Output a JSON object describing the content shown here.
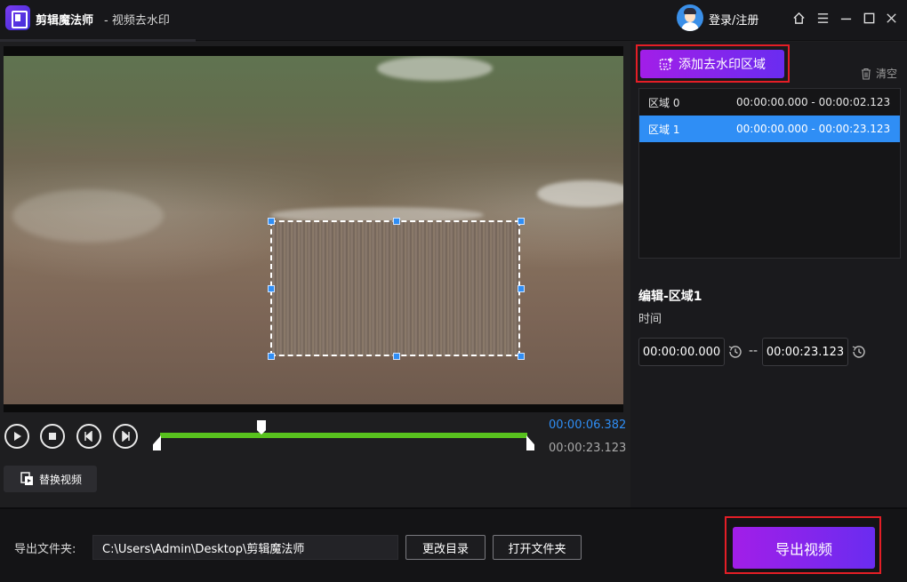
{
  "app": {
    "name": "剪辑魔法师",
    "subtitle": "- 视频去水印"
  },
  "header": {
    "login_label": "登录/注册"
  },
  "player": {
    "current_time": "00:00:06.382",
    "total_time": "00:00:23.123",
    "playhead_fraction": 0.276,
    "replace_video_label": "替换视频"
  },
  "watermark": {
    "add_region_label": "添加去水印区域",
    "clear_label": "清空",
    "regions": [
      {
        "name": "区域 0",
        "range": "00:00:00.000 - 00:00:02.123",
        "selected": false
      },
      {
        "name": "区域 1",
        "range": "00:00:00.000 - 00:00:23.123",
        "selected": true
      }
    ],
    "edit_title": "编辑-区域1",
    "time_label": "时间",
    "start_time": "00:00:00.000",
    "end_time": "00:00:23.123",
    "separator": "--"
  },
  "export": {
    "folder_label": "导出文件夹:",
    "folder_path": "C:\\Users\\Admin\\Desktop\\剪辑魔法师",
    "change_dir_label": "更改目录",
    "open_folder_label": "打开文件夹",
    "export_label": "导出视频"
  },
  "colors": {
    "accent_blue": "#2f8ef5",
    "accent_purple": "#8a24ec",
    "highlight_red": "#e41e26",
    "timeline_green": "#58c21e"
  }
}
